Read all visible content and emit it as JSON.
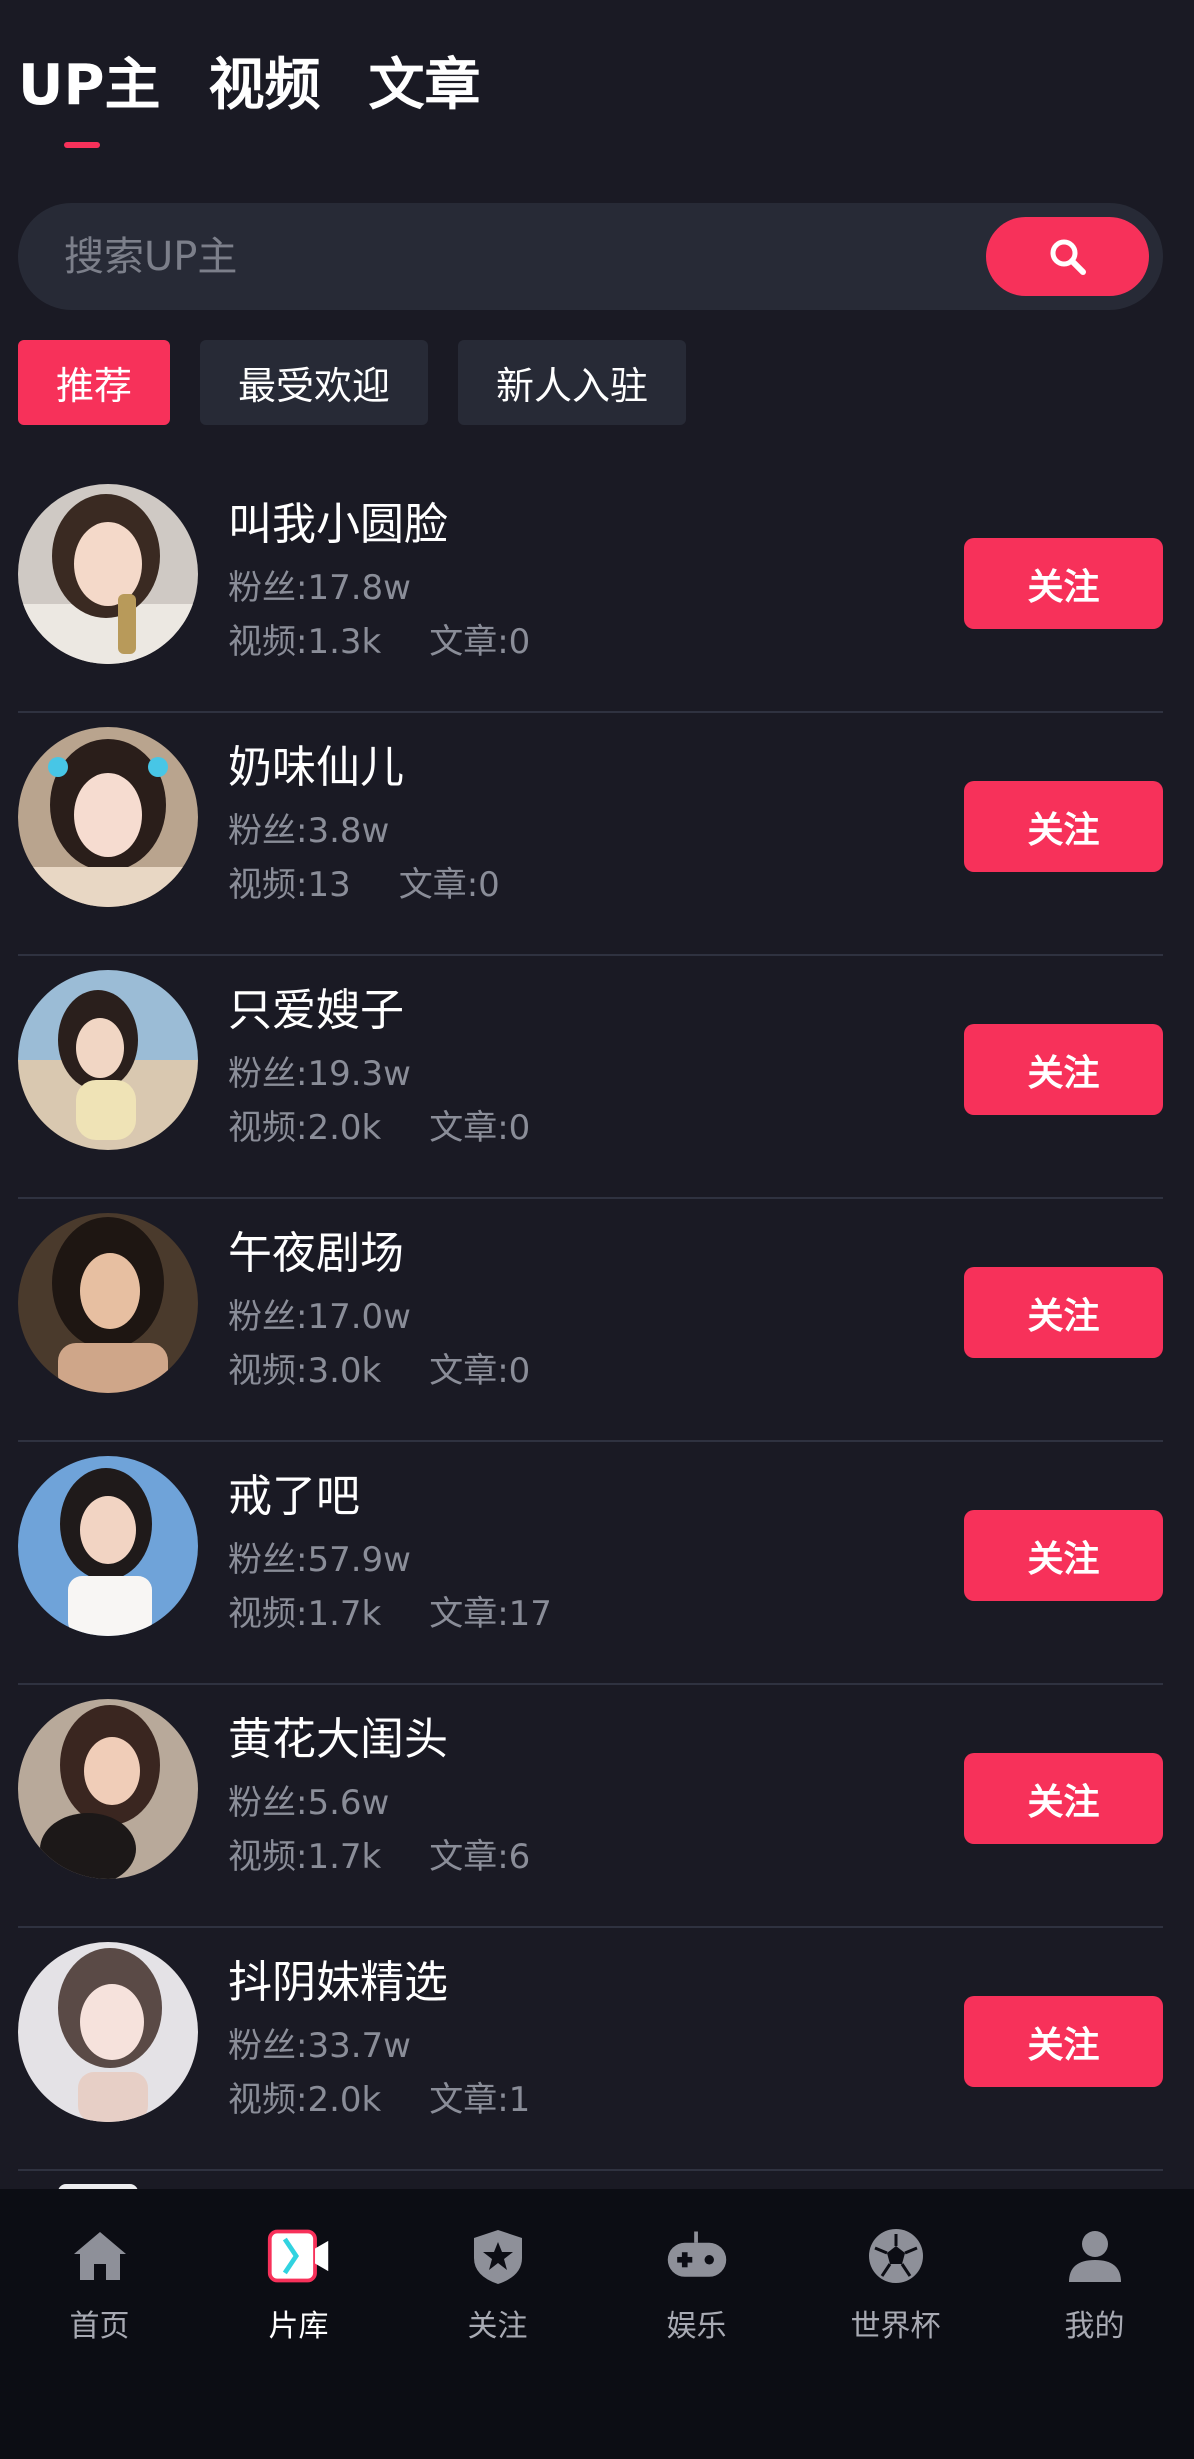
{
  "top_tabs": [
    {
      "label": "UP主",
      "active": true
    },
    {
      "label": "视频",
      "active": false
    },
    {
      "label": "文章",
      "active": false
    }
  ],
  "search": {
    "placeholder": "搜索UP主",
    "icon": "search-icon"
  },
  "filters": [
    {
      "label": "推荐",
      "active": true
    },
    {
      "label": "最受欢迎",
      "active": false
    },
    {
      "label": "新人入驻",
      "active": false
    }
  ],
  "creators": [
    {
      "name": "叫我小圆脸",
      "fans": "粉丝:17.8w",
      "videos": "视频:1.3k",
      "articles": "文章:0",
      "follow": "关注"
    },
    {
      "name": "奶味仙儿",
      "fans": "粉丝:3.8w",
      "videos": "视频:13",
      "articles": "文章:0",
      "follow": "关注"
    },
    {
      "name": "只爱嫂子",
      "fans": "粉丝:19.3w",
      "videos": "视频:2.0k",
      "articles": "文章:0",
      "follow": "关注"
    },
    {
      "name": "午夜剧场",
      "fans": "粉丝:17.0w",
      "videos": "视频:3.0k",
      "articles": "文章:0",
      "follow": "关注"
    },
    {
      "name": "戒了吧",
      "fans": "粉丝:57.9w",
      "videos": "视频:1.7k",
      "articles": "文章:17",
      "follow": "关注"
    },
    {
      "name": "黄花大闺头",
      "fans": "粉丝:5.6w",
      "videos": "视频:1.7k",
      "articles": "文章:6",
      "follow": "关注"
    },
    {
      "name": "抖阴妹精选",
      "fans": "粉丝:33.7w",
      "videos": "视频:2.0k",
      "articles": "文章:1",
      "follow": "关注"
    }
  ],
  "bottom_nav": [
    {
      "label": "首页",
      "icon": "home-icon",
      "active": false
    },
    {
      "label": "片库",
      "icon": "video-library-icon",
      "active": true
    },
    {
      "label": "关注",
      "icon": "star-shield-icon",
      "active": false
    },
    {
      "label": "娱乐",
      "icon": "gamepad-icon",
      "active": false
    },
    {
      "label": "世界杯",
      "icon": "soccer-ball-icon",
      "active": false
    },
    {
      "label": "我的",
      "icon": "user-icon",
      "active": false
    }
  ],
  "colors": {
    "accent": "#f7315a",
    "background": "#1a1a24",
    "surface": "#272a36",
    "nav_background": "#0c0d14",
    "muted_text": "#8a8d98"
  }
}
